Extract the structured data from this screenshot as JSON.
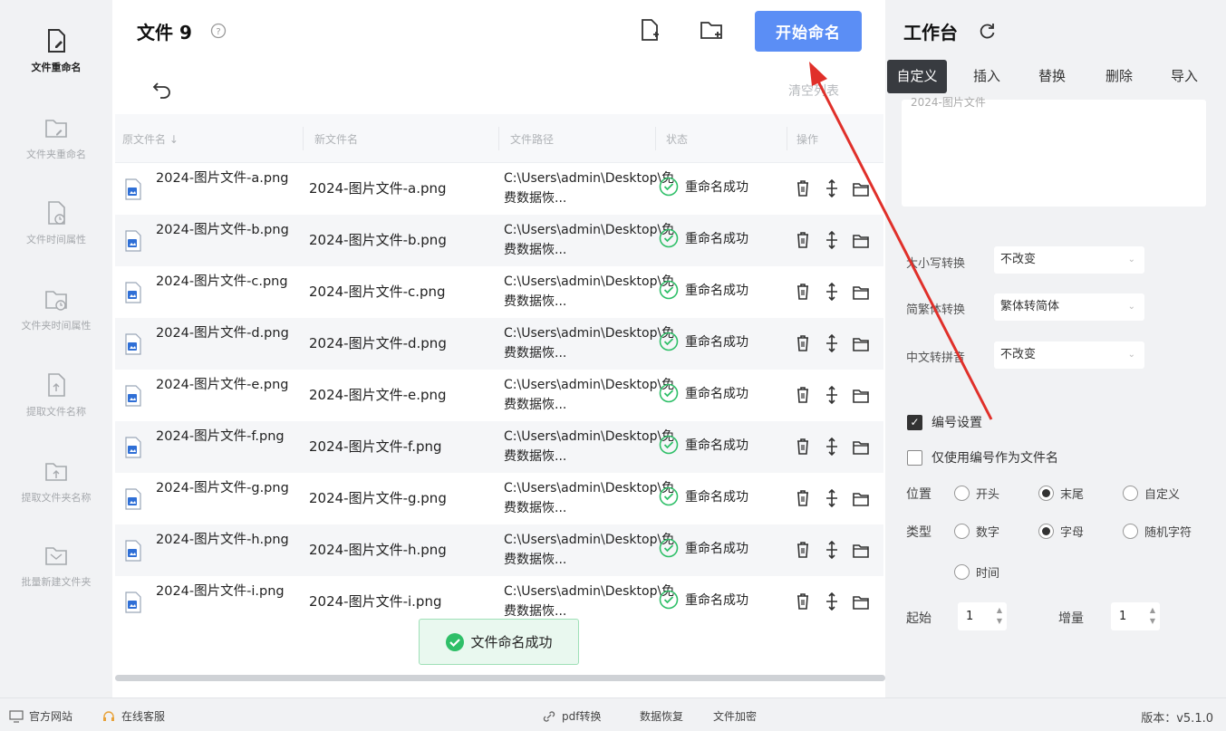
{
  "sidebar": {
    "items": [
      {
        "label": "文件重命名",
        "icon": "file-edit-icon",
        "active": true
      },
      {
        "label": "文件夹重命名",
        "icon": "folder-edit-icon",
        "active": false
      },
      {
        "label": "文件时间属性",
        "icon": "file-clock-icon",
        "active": false
      },
      {
        "label": "文件夹时间属性",
        "icon": "folder-clock-icon",
        "active": false
      },
      {
        "label": "提取文件名称",
        "icon": "file-extract-icon",
        "active": false
      },
      {
        "label": "提取文件夹名称",
        "icon": "folder-extract-icon",
        "active": false
      },
      {
        "label": "批量新建文件夹",
        "icon": "folder-new-icon",
        "active": false
      }
    ]
  },
  "header": {
    "title": "文件 9",
    "start_button": "开始命名",
    "clear_list": "清空列表"
  },
  "table": {
    "columns": [
      "原文件名 ↓",
      "新文件名",
      "文件路径",
      "状态",
      "操作"
    ],
    "rows": [
      {
        "orig": "2024-图片文件-a.png",
        "new": "2024-图片文件-a.png",
        "path": "C:\\Users\\admin\\Desktop\\免费数据恢...",
        "status": "重命名成功"
      },
      {
        "orig": "2024-图片文件-b.png",
        "new": "2024-图片文件-b.png",
        "path": "C:\\Users\\admin\\Desktop\\免费数据恢...",
        "status": "重命名成功"
      },
      {
        "orig": "2024-图片文件-c.png",
        "new": "2024-图片文件-c.png",
        "path": "C:\\Users\\admin\\Desktop\\免费数据恢...",
        "status": "重命名成功"
      },
      {
        "orig": "2024-图片文件-d.png",
        "new": "2024-图片文件-d.png",
        "path": "C:\\Users\\admin\\Desktop\\免费数据恢...",
        "status": "重命名成功"
      },
      {
        "orig": "2024-图片文件-e.png",
        "new": "2024-图片文件-e.png",
        "path": "C:\\Users\\admin\\Desktop\\免费数据恢...",
        "status": "重命名成功"
      },
      {
        "orig": "2024-图片文件-f.png",
        "new": "2024-图片文件-f.png",
        "path": "C:\\Users\\admin\\Desktop\\免费数据恢...",
        "status": "重命名成功"
      },
      {
        "orig": "2024-图片文件-g.png",
        "new": "2024-图片文件-g.png",
        "path": "C:\\Users\\admin\\Desktop\\免费数据恢...",
        "status": "重命名成功"
      },
      {
        "orig": "2024-图片文件-h.png",
        "new": "2024-图片文件-h.png",
        "path": "C:\\Users\\admin\\Desktop\\免费数据恢...",
        "status": "重命名成功"
      },
      {
        "orig": "2024-图片文件-i.png",
        "new": "2024-图片文件-i.png",
        "path": "C:\\Users\\admin\\Desktop\\免费数据恢...",
        "status": "重命名成功"
      }
    ]
  },
  "toast": "文件命名成功",
  "workspace": {
    "title": "工作台",
    "tabs": [
      "自定义",
      "插入",
      "替换",
      "删除",
      "导入"
    ],
    "active_tab": "自定义",
    "custom_text": "2024-图片文件",
    "case_label": "大小写转换",
    "case_value": "不改变",
    "trad_label": "简繁体转换",
    "trad_value": "繁体转简体",
    "pinyin_label": "中文转拼音",
    "pinyin_value": "不改变",
    "numbering_label": "编号设置",
    "numbering_checked": true,
    "only_number_label": "仅使用编号作为文件名",
    "only_number_checked": false,
    "position_label": "位置",
    "position_options": [
      "开头",
      "末尾",
      "自定义"
    ],
    "position_selected": "末尾",
    "type_label": "类型",
    "type_options": [
      "数字",
      "字母",
      "随机字符",
      "时间"
    ],
    "type_selected": "字母",
    "start_label": "起始",
    "start_value": "1",
    "step_label": "增量",
    "step_value": "1"
  },
  "footer": {
    "website": "官方网站",
    "service": "在线客服",
    "pdf": "pdf转换",
    "recovery": "数据恢复",
    "encrypt": "文件加密",
    "version": "版本：v5.1.0"
  },
  "colors": {
    "accent": "#5b8ef5",
    "success": "#2fbf68",
    "annotation_arrow": "#e0302a"
  }
}
